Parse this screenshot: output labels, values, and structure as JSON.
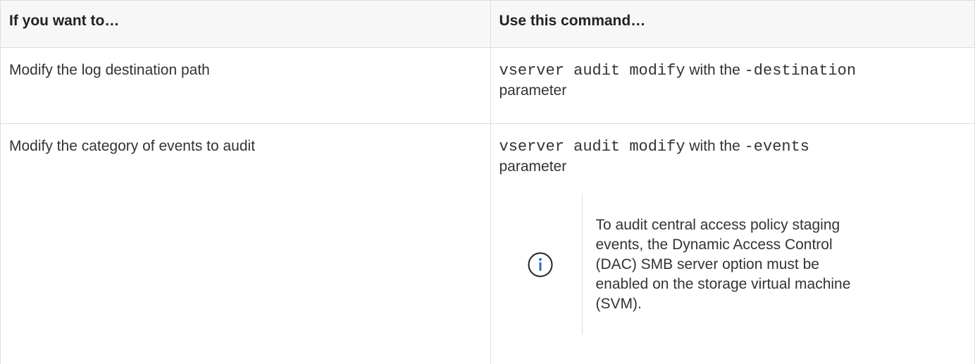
{
  "table": {
    "headers": [
      "If you want to…",
      "Use this command…"
    ],
    "rows": [
      {
        "action": "Modify the log destination path",
        "command": "vserver audit modify",
        "with_text": " with the ",
        "param": "-destination",
        "suffix": "parameter"
      },
      {
        "action": "Modify the category of events to audit",
        "command": "vserver audit modify",
        "with_text": " with the ",
        "param": "-events",
        "suffix": "parameter",
        "note": {
          "icon": "info-icon",
          "icon_color": "#1565c0",
          "text": "To audit central access policy staging events, the Dynamic Access Control (DAC) SMB server option must be enabled on the storage virtual machine (SVM)."
        }
      }
    ]
  }
}
